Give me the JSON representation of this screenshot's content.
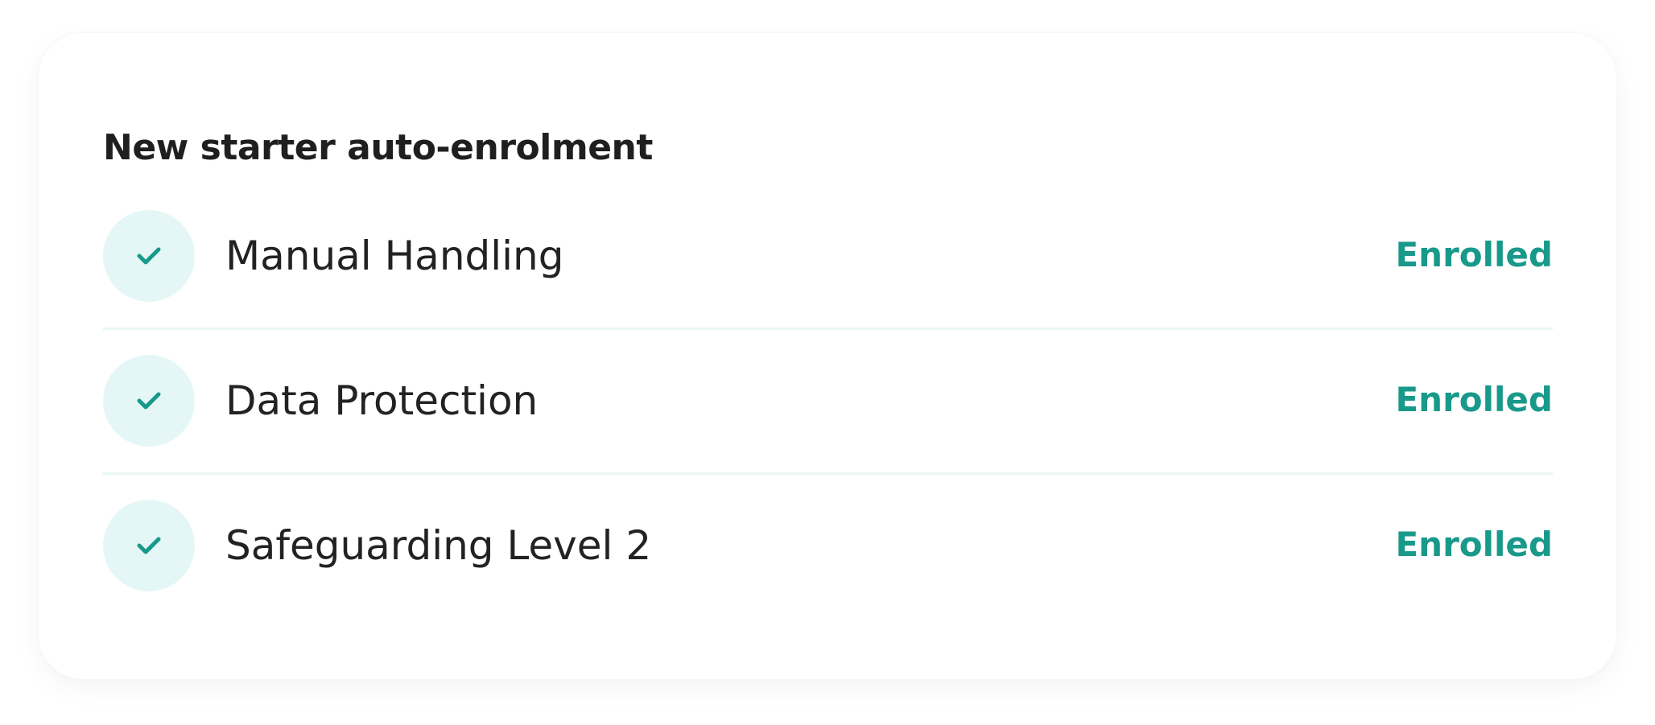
{
  "card": {
    "title": "New starter auto-enrolment"
  },
  "colors": {
    "accent": "#18998a",
    "badge_background": "#e4f7f6",
    "divider": "#e9f7f6",
    "text": "#222222"
  },
  "courses": [
    {
      "name": "Manual Handling",
      "status": "Enrolled",
      "icon": "check-icon"
    },
    {
      "name": "Data Protection",
      "status": "Enrolled",
      "icon": "check-icon"
    },
    {
      "name": "Safeguarding Level 2",
      "status": "Enrolled",
      "icon": "check-icon"
    }
  ]
}
